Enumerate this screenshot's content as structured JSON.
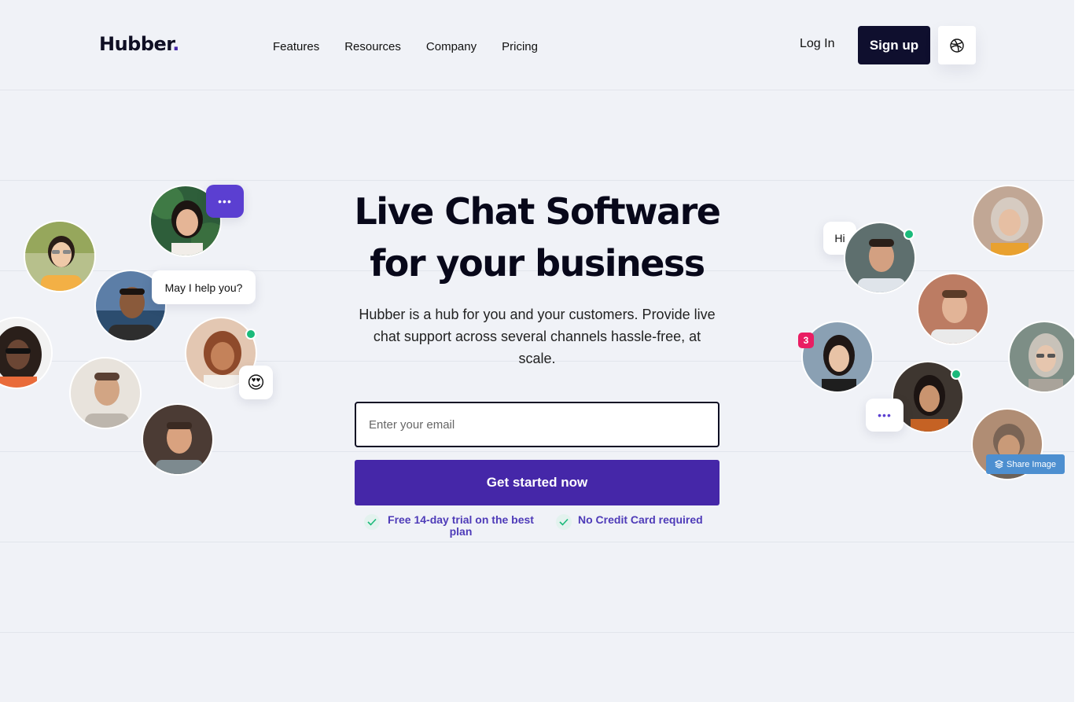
{
  "header": {
    "logo_text": "Hubber",
    "logo_dot": ".",
    "nav": [
      "Features",
      "Resources",
      "Company",
      "Pricing"
    ],
    "login_label": "Log In",
    "signup_label": "Sign up"
  },
  "hero": {
    "title_line1": "Live Chat Software",
    "title_line2": "for your business",
    "subtitle": "Hubber is a hub for you and your customers. Provide live chat support across several channels hassle-free, at scale.",
    "email_placeholder": "Enter your email",
    "cta_label": "Get started now",
    "perks": [
      "Free 14-day trial on the best plan",
      "No Credit Card required"
    ]
  },
  "chat_bubbles": {
    "help": "May I help you?",
    "hi": "Hi",
    "typing": "•••",
    "emoji": "😍",
    "unread_count": "3"
  },
  "share_button_label": "Share Image",
  "colors": {
    "brand": "#4527a8",
    "dark": "#0f0f2e",
    "background": "#f0f2f7",
    "online": "#1bba7b",
    "badge": "#e91e63"
  },
  "icons": [
    "globe-icon",
    "check-icon",
    "layers-icon"
  ]
}
